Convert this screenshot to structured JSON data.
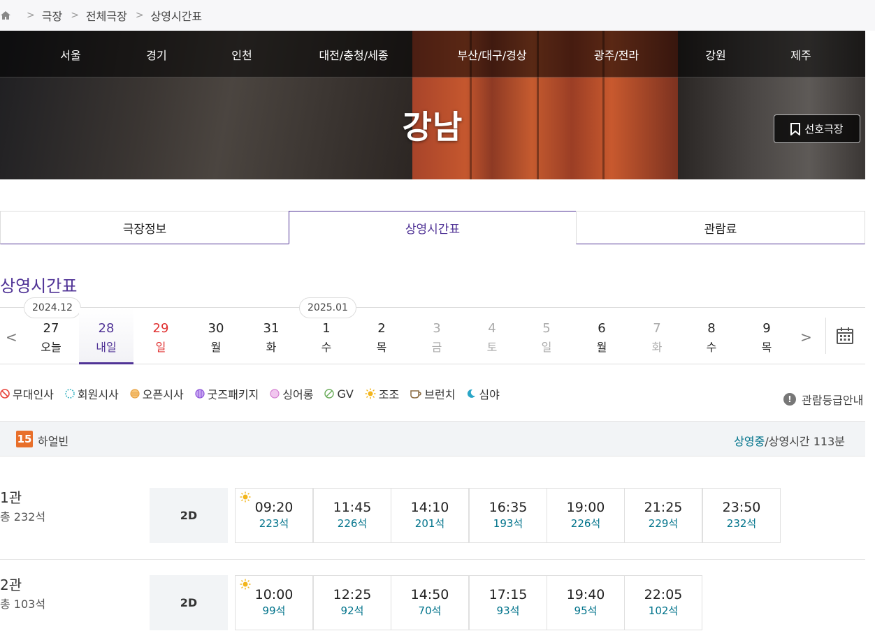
{
  "breadcrumb": {
    "items": [
      "극장",
      "전체극장",
      "상영시간표"
    ]
  },
  "hero": {
    "regions": [
      "서울",
      "경기",
      "인천",
      "대전/충청/세종",
      "부산/대구/경상",
      "광주/전라",
      "강원",
      "제주"
    ],
    "theater_name": "강남",
    "favorite_label": "선호극장"
  },
  "tabs": [
    {
      "label": "극장정보",
      "active": false
    },
    {
      "label": "상영시간표",
      "active": true
    },
    {
      "label": "관람료",
      "active": false
    }
  ],
  "section_title": "상영시간표",
  "dates": {
    "month_tags": [
      "2024.12",
      "2025.01"
    ],
    "days": [
      {
        "num": "27",
        "dow": "오늘",
        "state": "normal"
      },
      {
        "num": "28",
        "dow": "내일",
        "state": "selected"
      },
      {
        "num": "29",
        "dow": "일",
        "state": "sunday"
      },
      {
        "num": "30",
        "dow": "월",
        "state": "normal"
      },
      {
        "num": "31",
        "dow": "화",
        "state": "normal"
      },
      {
        "num": "1",
        "dow": "수",
        "state": "normal"
      },
      {
        "num": "2",
        "dow": "목",
        "state": "normal"
      },
      {
        "num": "3",
        "dow": "금",
        "state": "disabled"
      },
      {
        "num": "4",
        "dow": "토",
        "state": "disabled"
      },
      {
        "num": "5",
        "dow": "일",
        "state": "disabled"
      },
      {
        "num": "6",
        "dow": "월",
        "state": "normal"
      },
      {
        "num": "7",
        "dow": "화",
        "state": "disabled"
      },
      {
        "num": "8",
        "dow": "수",
        "state": "normal"
      },
      {
        "num": "9",
        "dow": "목",
        "state": "normal"
      }
    ]
  },
  "legend": [
    {
      "label": "무대인사",
      "color": "#e8453c",
      "icon": "stage-greeting-icon"
    },
    {
      "label": "회원시사",
      "color": "#41b6c4",
      "icon": "member-preview-icon"
    },
    {
      "label": "오픈시사",
      "color": "#e8a040",
      "icon": "open-preview-icon"
    },
    {
      "label": "굿즈패키지",
      "color": "#8a4fd8",
      "icon": "goods-package-icon"
    },
    {
      "label": "싱어롱",
      "color": "#d47fd0",
      "icon": "singalong-icon"
    },
    {
      "label": "GV",
      "color": "#6aac5a",
      "icon": "gv-icon"
    },
    {
      "label": "조조",
      "color": "#f2b51c",
      "icon": "sun-icon"
    },
    {
      "label": "브런치",
      "color": "#8a6a40",
      "icon": "coffee-cup-icon"
    },
    {
      "label": "심야",
      "color": "#2aa6c7",
      "icon": "moon-icon"
    }
  ],
  "rating_guide_label": "관람등급안내",
  "movie": {
    "age": "15",
    "title": "하얼빈",
    "status": "상영중",
    "runtime": "/상영시간 113분"
  },
  "screens": [
    {
      "name": "1관",
      "seats": "총 232석",
      "format": "2D",
      "times": [
        {
          "time": "09:20",
          "seats": "223석",
          "early": true
        },
        {
          "time": "11:45",
          "seats": "226석",
          "early": false
        },
        {
          "time": "14:10",
          "seats": "201석",
          "early": false
        },
        {
          "time": "16:35",
          "seats": "193석",
          "early": false
        },
        {
          "time": "19:00",
          "seats": "226석",
          "early": false
        },
        {
          "time": "21:25",
          "seats": "229석",
          "early": false
        },
        {
          "time": "23:50",
          "seats": "232석",
          "early": false
        }
      ]
    },
    {
      "name": "2관",
      "seats": "총 103석",
      "format": "2D",
      "times": [
        {
          "time": "10:00",
          "seats": "99석",
          "early": true
        },
        {
          "time": "12:25",
          "seats": "92석",
          "early": false
        },
        {
          "time": "14:50",
          "seats": "70석",
          "early": false
        },
        {
          "time": "17:15",
          "seats": "93석",
          "early": false
        },
        {
          "time": "19:40",
          "seats": "95석",
          "early": false
        },
        {
          "time": "22:05",
          "seats": "102석",
          "early": false
        }
      ]
    }
  ]
}
